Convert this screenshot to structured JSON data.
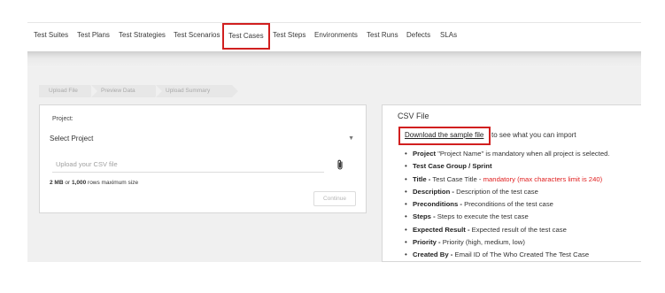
{
  "nav": {
    "tabs": [
      {
        "label": "Test Suites"
      },
      {
        "label": "Test Plans"
      },
      {
        "label": "Test Strategies"
      },
      {
        "label": "Test Scenarios"
      },
      {
        "label": "Test Cases",
        "active": true
      },
      {
        "label": "Test Steps"
      },
      {
        "label": "Environments"
      },
      {
        "label": "Test Runs"
      },
      {
        "label": "Defects"
      },
      {
        "label": "SLAs"
      }
    ]
  },
  "wizard": {
    "steps": [
      "Upload File",
      "Preview Data",
      "Upload Summary"
    ]
  },
  "form": {
    "project_label": "Project:",
    "project_value": "Select Project",
    "upload_placeholder": "Upload your CSV file",
    "limit_size": "2 MB",
    "limit_or": " or ",
    "limit_rows": "1,000",
    "limit_rest": " rows maximum size",
    "continue_label": "Continue"
  },
  "csv": {
    "title": "CSV File",
    "download_link": "Download the sample file",
    "download_rest": " to see what you can import",
    "fields": [
      {
        "name": "Project",
        "sep": " ",
        "desc": "\"Project Name\" is mandatory when all project is selected.",
        "red": ""
      },
      {
        "name": "Test Case Group / Sprint",
        "sep": "",
        "desc": "",
        "red": ""
      },
      {
        "name": "Title -",
        "sep": " ",
        "desc": "Test Case Title - ",
        "red": "mandatory (max characters limit is 240)"
      },
      {
        "name": "Description -",
        "sep": " ",
        "desc": "Description of the test case",
        "red": ""
      },
      {
        "name": "Preconditions -",
        "sep": " ",
        "desc": "Preconditions of the test case",
        "red": ""
      },
      {
        "name": "Steps -",
        "sep": " ",
        "desc": "Steps to execute the test case",
        "red": ""
      },
      {
        "name": "Expected Result -",
        "sep": " ",
        "desc": "Expected result of the test case",
        "red": ""
      },
      {
        "name": "Priority -",
        "sep": " ",
        "desc": "Priority (high, medium, low)",
        "red": ""
      },
      {
        "name": "Created By -",
        "sep": " ",
        "desc": "Email ID of The Who Created The Test Case",
        "red": ""
      }
    ]
  },
  "colors": {
    "highlight": "#d11f1f",
    "mandatory": "#e02020"
  }
}
